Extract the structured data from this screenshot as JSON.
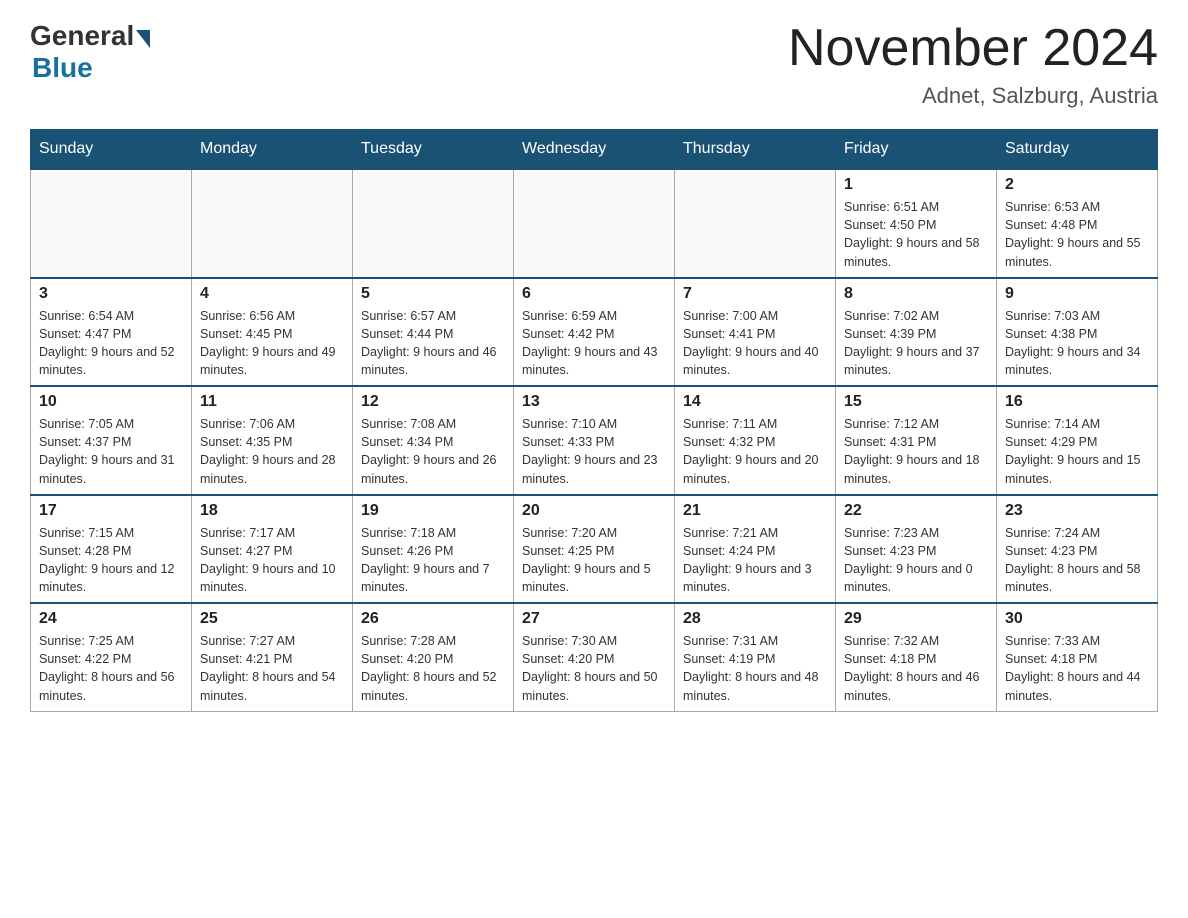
{
  "header": {
    "logo_general": "General",
    "logo_blue": "Blue",
    "month_title": "November 2024",
    "location": "Adnet, Salzburg, Austria"
  },
  "days_of_week": [
    "Sunday",
    "Monday",
    "Tuesday",
    "Wednesday",
    "Thursday",
    "Friday",
    "Saturday"
  ],
  "weeks": [
    [
      {
        "day": "",
        "info": ""
      },
      {
        "day": "",
        "info": ""
      },
      {
        "day": "",
        "info": ""
      },
      {
        "day": "",
        "info": ""
      },
      {
        "day": "",
        "info": ""
      },
      {
        "day": "1",
        "info": "Sunrise: 6:51 AM\nSunset: 4:50 PM\nDaylight: 9 hours and 58 minutes."
      },
      {
        "day": "2",
        "info": "Sunrise: 6:53 AM\nSunset: 4:48 PM\nDaylight: 9 hours and 55 minutes."
      }
    ],
    [
      {
        "day": "3",
        "info": "Sunrise: 6:54 AM\nSunset: 4:47 PM\nDaylight: 9 hours and 52 minutes."
      },
      {
        "day": "4",
        "info": "Sunrise: 6:56 AM\nSunset: 4:45 PM\nDaylight: 9 hours and 49 minutes."
      },
      {
        "day": "5",
        "info": "Sunrise: 6:57 AM\nSunset: 4:44 PM\nDaylight: 9 hours and 46 minutes."
      },
      {
        "day": "6",
        "info": "Sunrise: 6:59 AM\nSunset: 4:42 PM\nDaylight: 9 hours and 43 minutes."
      },
      {
        "day": "7",
        "info": "Sunrise: 7:00 AM\nSunset: 4:41 PM\nDaylight: 9 hours and 40 minutes."
      },
      {
        "day": "8",
        "info": "Sunrise: 7:02 AM\nSunset: 4:39 PM\nDaylight: 9 hours and 37 minutes."
      },
      {
        "day": "9",
        "info": "Sunrise: 7:03 AM\nSunset: 4:38 PM\nDaylight: 9 hours and 34 minutes."
      }
    ],
    [
      {
        "day": "10",
        "info": "Sunrise: 7:05 AM\nSunset: 4:37 PM\nDaylight: 9 hours and 31 minutes."
      },
      {
        "day": "11",
        "info": "Sunrise: 7:06 AM\nSunset: 4:35 PM\nDaylight: 9 hours and 28 minutes."
      },
      {
        "day": "12",
        "info": "Sunrise: 7:08 AM\nSunset: 4:34 PM\nDaylight: 9 hours and 26 minutes."
      },
      {
        "day": "13",
        "info": "Sunrise: 7:10 AM\nSunset: 4:33 PM\nDaylight: 9 hours and 23 minutes."
      },
      {
        "day": "14",
        "info": "Sunrise: 7:11 AM\nSunset: 4:32 PM\nDaylight: 9 hours and 20 minutes."
      },
      {
        "day": "15",
        "info": "Sunrise: 7:12 AM\nSunset: 4:31 PM\nDaylight: 9 hours and 18 minutes."
      },
      {
        "day": "16",
        "info": "Sunrise: 7:14 AM\nSunset: 4:29 PM\nDaylight: 9 hours and 15 minutes."
      }
    ],
    [
      {
        "day": "17",
        "info": "Sunrise: 7:15 AM\nSunset: 4:28 PM\nDaylight: 9 hours and 12 minutes."
      },
      {
        "day": "18",
        "info": "Sunrise: 7:17 AM\nSunset: 4:27 PM\nDaylight: 9 hours and 10 minutes."
      },
      {
        "day": "19",
        "info": "Sunrise: 7:18 AM\nSunset: 4:26 PM\nDaylight: 9 hours and 7 minutes."
      },
      {
        "day": "20",
        "info": "Sunrise: 7:20 AM\nSunset: 4:25 PM\nDaylight: 9 hours and 5 minutes."
      },
      {
        "day": "21",
        "info": "Sunrise: 7:21 AM\nSunset: 4:24 PM\nDaylight: 9 hours and 3 minutes."
      },
      {
        "day": "22",
        "info": "Sunrise: 7:23 AM\nSunset: 4:23 PM\nDaylight: 9 hours and 0 minutes."
      },
      {
        "day": "23",
        "info": "Sunrise: 7:24 AM\nSunset: 4:23 PM\nDaylight: 8 hours and 58 minutes."
      }
    ],
    [
      {
        "day": "24",
        "info": "Sunrise: 7:25 AM\nSunset: 4:22 PM\nDaylight: 8 hours and 56 minutes."
      },
      {
        "day": "25",
        "info": "Sunrise: 7:27 AM\nSunset: 4:21 PM\nDaylight: 8 hours and 54 minutes."
      },
      {
        "day": "26",
        "info": "Sunrise: 7:28 AM\nSunset: 4:20 PM\nDaylight: 8 hours and 52 minutes."
      },
      {
        "day": "27",
        "info": "Sunrise: 7:30 AM\nSunset: 4:20 PM\nDaylight: 8 hours and 50 minutes."
      },
      {
        "day": "28",
        "info": "Sunrise: 7:31 AM\nSunset: 4:19 PM\nDaylight: 8 hours and 48 minutes."
      },
      {
        "day": "29",
        "info": "Sunrise: 7:32 AM\nSunset: 4:18 PM\nDaylight: 8 hours and 46 minutes."
      },
      {
        "day": "30",
        "info": "Sunrise: 7:33 AM\nSunset: 4:18 PM\nDaylight: 8 hours and 44 minutes."
      }
    ]
  ]
}
